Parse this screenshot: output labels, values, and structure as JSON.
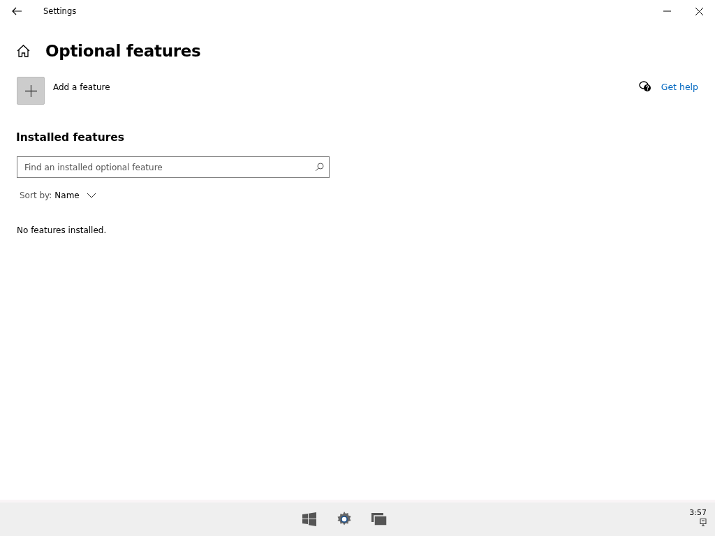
{
  "window": {
    "title": "Settings"
  },
  "page": {
    "title": "Optional features",
    "add_button": "Add a feature",
    "help_link": "Get help"
  },
  "installed": {
    "heading": "Installed features",
    "search": {
      "placeholder": "Find an installed optional feature"
    },
    "sort": {
      "label": "Sort by:",
      "value": "Name"
    },
    "empty_message": "No features installed."
  },
  "taskbar": {
    "clock": "3:57"
  }
}
